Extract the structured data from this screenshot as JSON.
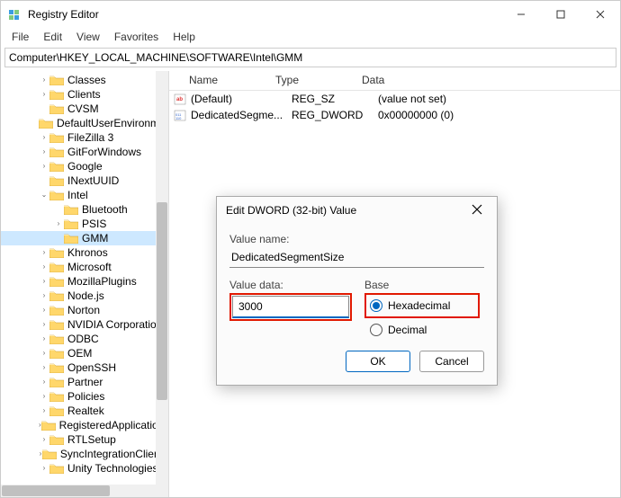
{
  "window": {
    "title": "Registry Editor"
  },
  "menu": {
    "file": "File",
    "edit": "Edit",
    "view": "View",
    "favorites": "Favorites",
    "help": "Help"
  },
  "address": "Computer\\HKEY_LOCAL_MACHINE\\SOFTWARE\\Intel\\GMM",
  "tree": {
    "items": [
      {
        "indent": 42,
        "caret": "›",
        "label": "Classes"
      },
      {
        "indent": 42,
        "caret": "›",
        "label": "Clients"
      },
      {
        "indent": 42,
        "caret": "",
        "label": "CVSM"
      },
      {
        "indent": 42,
        "caret": "",
        "label": "DefaultUserEnvironment"
      },
      {
        "indent": 42,
        "caret": "›",
        "label": "FileZilla 3"
      },
      {
        "indent": 42,
        "caret": "›",
        "label": "GitForWindows"
      },
      {
        "indent": 42,
        "caret": "›",
        "label": "Google"
      },
      {
        "indent": 42,
        "caret": "",
        "label": "INextUUID"
      },
      {
        "indent": 42,
        "caret": "⌄",
        "label": "Intel",
        "expanded": true
      },
      {
        "indent": 58,
        "caret": "",
        "label": "Bluetooth"
      },
      {
        "indent": 58,
        "caret": "›",
        "label": "PSIS"
      },
      {
        "indent": 58,
        "caret": "",
        "label": "GMM",
        "selected": true
      },
      {
        "indent": 42,
        "caret": "›",
        "label": "Khronos"
      },
      {
        "indent": 42,
        "caret": "›",
        "label": "Microsoft"
      },
      {
        "indent": 42,
        "caret": "›",
        "label": "MozillaPlugins"
      },
      {
        "indent": 42,
        "caret": "›",
        "label": "Node.js"
      },
      {
        "indent": 42,
        "caret": "›",
        "label": "Norton"
      },
      {
        "indent": 42,
        "caret": "›",
        "label": "NVIDIA Corporation"
      },
      {
        "indent": 42,
        "caret": "›",
        "label": "ODBC"
      },
      {
        "indent": 42,
        "caret": "›",
        "label": "OEM"
      },
      {
        "indent": 42,
        "caret": "›",
        "label": "OpenSSH"
      },
      {
        "indent": 42,
        "caret": "›",
        "label": "Partner"
      },
      {
        "indent": 42,
        "caret": "›",
        "label": "Policies"
      },
      {
        "indent": 42,
        "caret": "›",
        "label": "Realtek"
      },
      {
        "indent": 42,
        "caret": "›",
        "label": "RegisteredApplications"
      },
      {
        "indent": 42,
        "caret": "›",
        "label": "RTLSetup"
      },
      {
        "indent": 42,
        "caret": "›",
        "label": "SyncIntegrationClients"
      },
      {
        "indent": 42,
        "caret": "›",
        "label": "Unity Technologies"
      }
    ]
  },
  "list": {
    "headers": {
      "name": "Name",
      "type": "Type",
      "data": "Data"
    },
    "rows": [
      {
        "icon": "sz",
        "name": "(Default)",
        "type": "REG_SZ",
        "data": "(value not set)"
      },
      {
        "icon": "bin",
        "name": "DedicatedSegme...",
        "type": "REG_DWORD",
        "data": "0x00000000 (0)"
      }
    ]
  },
  "dialog": {
    "title": "Edit DWORD (32-bit) Value",
    "value_name_label": "Value name:",
    "value_name": "DedicatedSegmentSize",
    "value_data_label": "Value data:",
    "value_data": "3000",
    "base_label": "Base",
    "hex_label": "Hexadecimal",
    "dec_label": "Decimal",
    "ok": "OK",
    "cancel": "Cancel"
  }
}
